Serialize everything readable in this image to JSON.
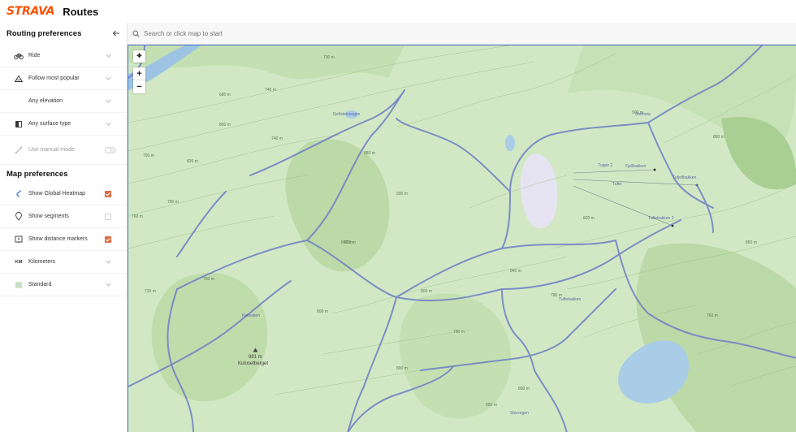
{
  "header": {
    "logo": "STRAVA",
    "title": "Routes"
  },
  "sidebar": {
    "routing_title": "Routing preferences",
    "routing_items": [
      {
        "label": "Ride",
        "icon": "bike-icon"
      },
      {
        "label": "Follow most popular",
        "icon": "popular-icon"
      },
      {
        "label": "Any elevation",
        "icon": "elevation-icon"
      },
      {
        "label": "Any surface type",
        "icon": "surface-icon"
      },
      {
        "label": "Use manual mode",
        "icon": "manual-icon"
      }
    ],
    "map_title": "Map preferences",
    "map_items": [
      {
        "label": "Show Global Heatmap",
        "checked": true,
        "icon": "heatmap-icon"
      },
      {
        "label": "Show segments",
        "checked": false,
        "icon": "segment-pin-icon"
      },
      {
        "label": "Show distance markers",
        "checked": true,
        "icon": "distance-marker-icon"
      },
      {
        "label": "Kilometers",
        "icon": "km-icon",
        "icon_text": "KM"
      },
      {
        "label": "Standard",
        "icon": "map-style-icon"
      }
    ]
  },
  "search": {
    "placeholder": "Search or click map to start"
  },
  "map": {
    "controls": {
      "locate": "⌖",
      "zoom_in": "+",
      "zoom_out": "−"
    },
    "contours": [
      "700 m",
      "680 m",
      "740 m",
      "800 m",
      "820 m",
      "840 m",
      "740 m",
      "760 m",
      "780 m",
      "760 m",
      "800 m",
      "780 m",
      "800 m",
      "760 m",
      "780 m",
      "820 m",
      "860 m",
      "880 m",
      "900 m",
      "800 m",
      "900 m",
      "840 m",
      "920 m",
      "800 m",
      "720 m",
      "760 m",
      "880 m",
      "800 m"
    ],
    "paths": [
      "Tuppe 2",
      "Fjellbakken",
      "Fjellsteinvegen",
      "Storheia",
      "Tufte",
      "Tufjellbakken",
      "Tuftebakken 2",
      "Tuftebakken",
      "Kirkestien",
      "Storvegen"
    ],
    "peak": {
      "elevation": "981 m",
      "name": "Kulusetberget"
    },
    "colors": {
      "land": "#d2e8c4",
      "forest": "#bfdcab",
      "water": "#a9cde6",
      "route": "#6e7fc4",
      "border": "#4a76c9"
    }
  }
}
